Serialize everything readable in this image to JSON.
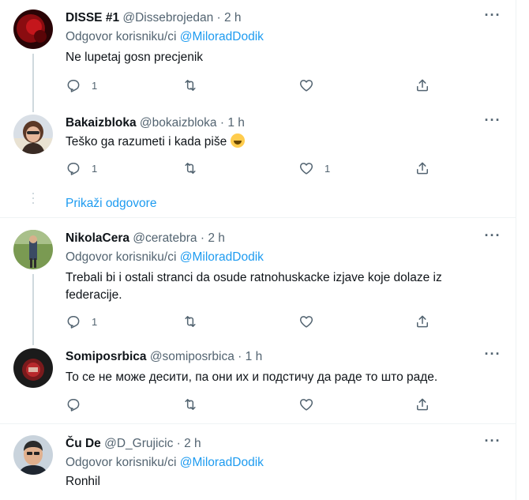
{
  "colors": {
    "accent": "#1d9bf0",
    "secondary_text": "#536471",
    "divider": "#eff3f4"
  },
  "icons": {
    "reply": "reply-icon",
    "retweet": "retweet-icon",
    "like": "heart-icon",
    "share": "share-icon",
    "more": "more-icon"
  },
  "tweets": [
    {
      "name": "DISSE #1",
      "handle": "@Dissebrojedan",
      "dot": "·",
      "time": "2 h",
      "reply_prefix": "Odgovor korisniku/ci ",
      "reply_mention": "@MiloradDodik",
      "text": "Ne lupetaj gosn precjenik",
      "reply_count": "1",
      "retweet_count": "",
      "like_count": ""
    },
    {
      "name": "Bakaizbloka",
      "handle": "@bokaizbloka",
      "dot": "·",
      "time": "1 h",
      "text": "Teško ga razumeti i kada piše",
      "emoji": "rolling-on-floor-laughing-emoji",
      "reply_count": "1",
      "retweet_count": "",
      "like_count": "1"
    },
    {
      "name": "NikolaCera",
      "handle": "@ceratebra",
      "dot": "·",
      "time": "2 h",
      "reply_prefix": "Odgovor korisniku/ci ",
      "reply_mention": "@MiloradDodik",
      "text_line1": "Trebali bi i ostali stranci da osude ratnohuskacke izjave koje dolaze iz",
      "text_line2": "federacije.",
      "reply_count": "1",
      "retweet_count": "",
      "like_count": ""
    },
    {
      "name": "Somiposrbica",
      "handle": "@somiposrbica",
      "dot": "·",
      "time": "1 h",
      "text": "То се не може десити, па они их и подстичу да раде то што раде.",
      "reply_count": "",
      "retweet_count": "",
      "like_count": ""
    },
    {
      "name": "Ču De",
      "handle": "@D_Grujicic",
      "dot": "·",
      "time": "2 h",
      "reply_prefix": "Odgovor korisniku/ci ",
      "reply_mention": "@MiloradDodik",
      "text": "Ronhil"
    }
  ],
  "show_replies": "Prikaži odgovore",
  "more_label": "···"
}
